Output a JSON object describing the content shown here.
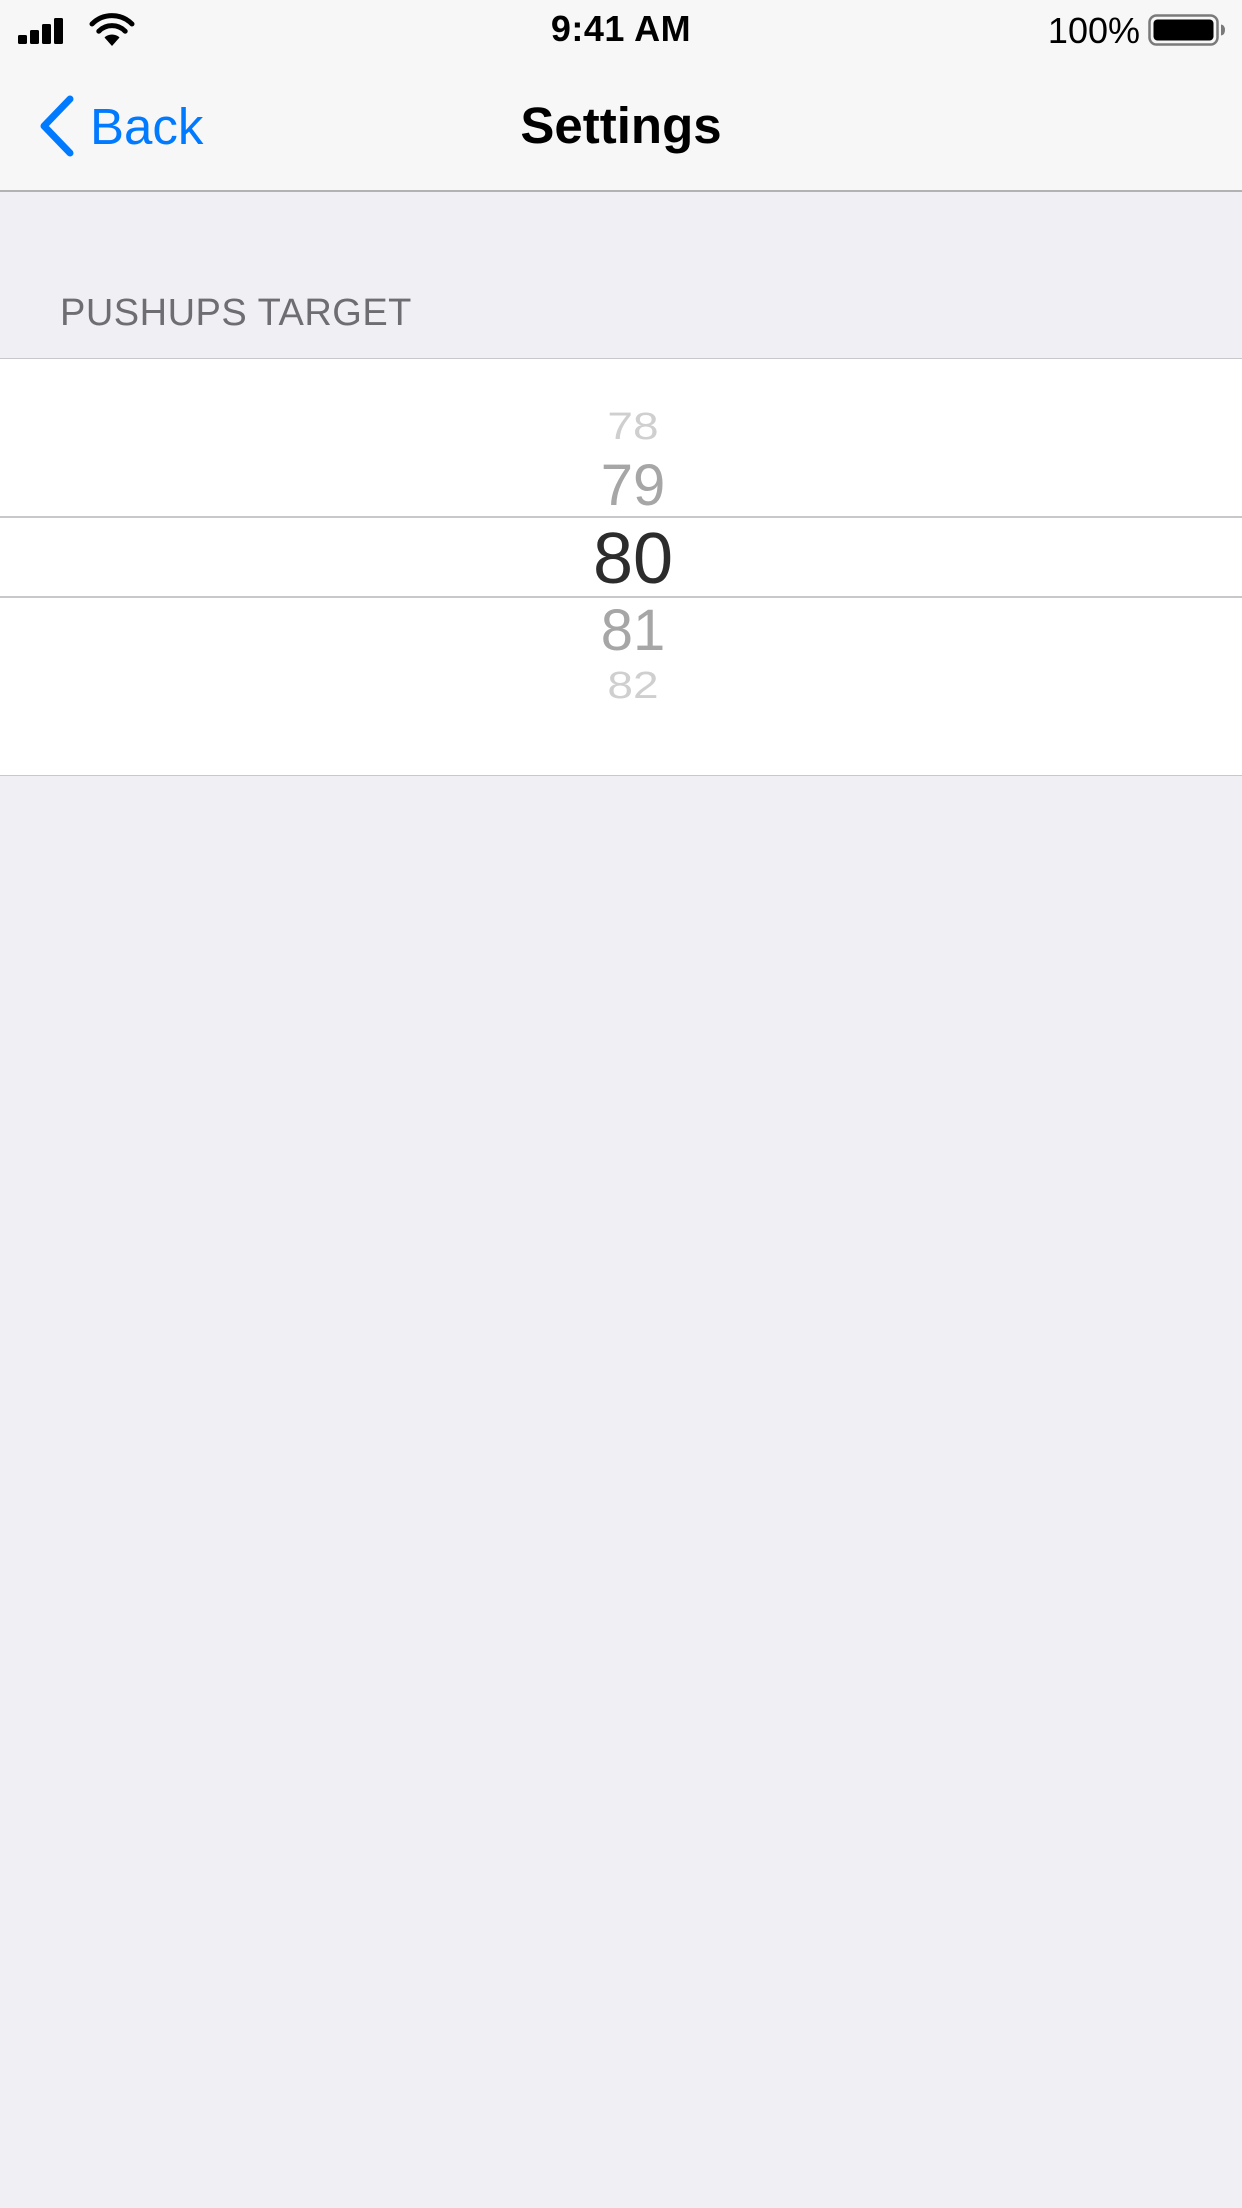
{
  "status_bar": {
    "time": "9:41 AM",
    "battery_percent": "100%",
    "signal_bars": 4,
    "battery_level": 1.0
  },
  "nav": {
    "back_label": "Back",
    "title": "Settings"
  },
  "section": {
    "header": "PUSHUPS TARGET"
  },
  "picker": {
    "selected_value": 80,
    "options": {
      "far_above": "78",
      "near_above": "79",
      "selected": "80",
      "near_below": "81",
      "far_below": "82"
    }
  },
  "colors": {
    "accent": "#007aff",
    "background": "#efeff4",
    "bar_background": "#f7f7f7",
    "section_header": "#6d6d72",
    "separator": "#c8c7cc"
  },
  "icons": {
    "signal": "cellular-signal-icon",
    "wifi": "wifi-icon",
    "battery": "battery-icon",
    "back": "chevron-left-icon"
  }
}
